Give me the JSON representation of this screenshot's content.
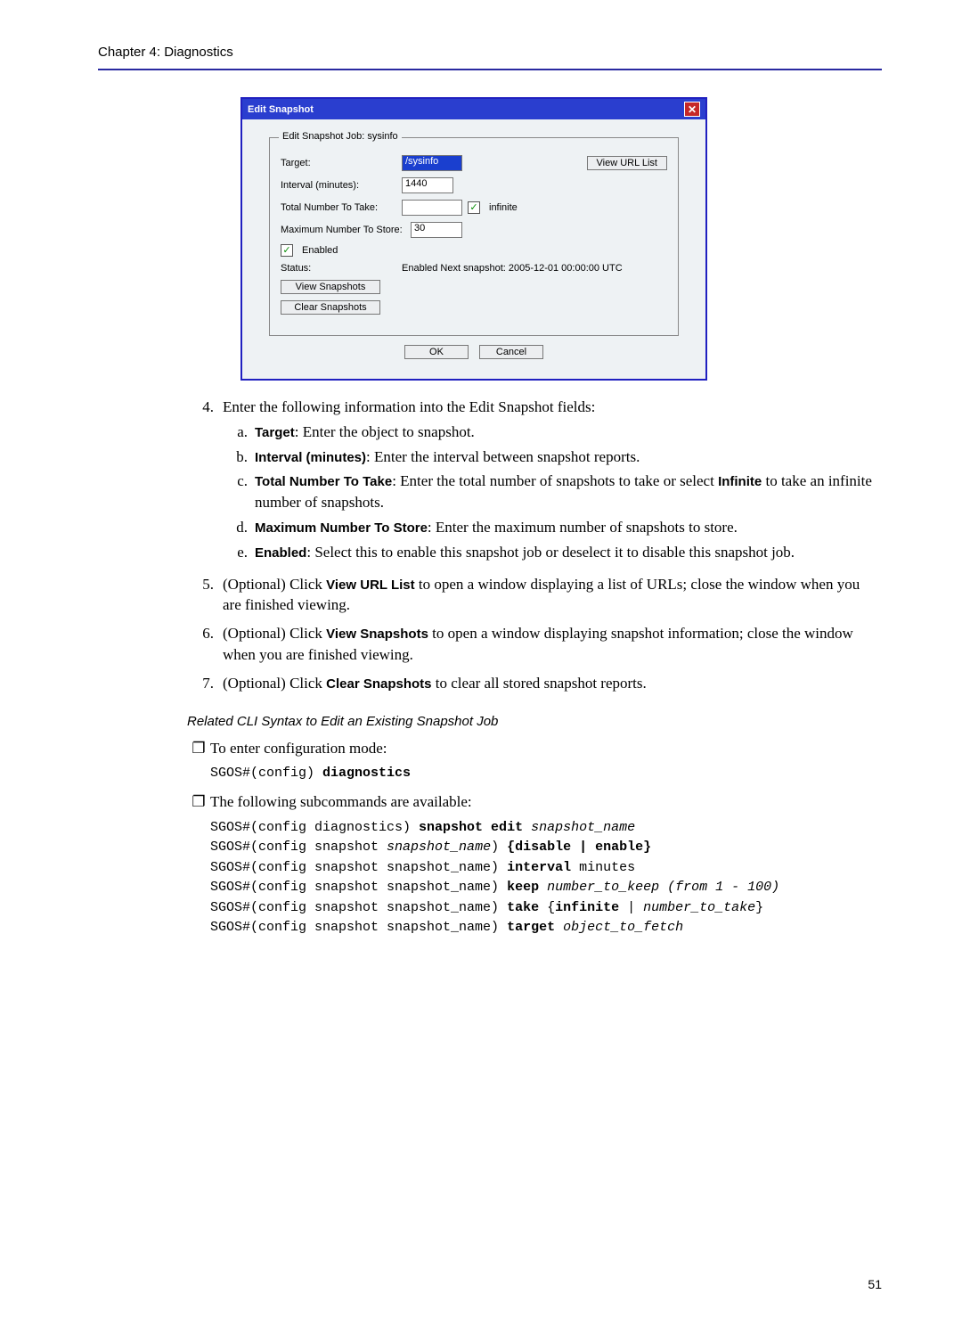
{
  "header": "Chapter 4:   Diagnostics",
  "dialog": {
    "title": "Edit Snapshot",
    "legend": "Edit Snapshot Job: sysinfo",
    "labels": {
      "target": "Target:",
      "interval": "Interval (minutes):",
      "total": "Total Number To Take:",
      "max": "Maximum Number To Store:",
      "enabled_cb": "Enabled",
      "infinite_cb": "infinite",
      "status": "Status:"
    },
    "values": {
      "target": "/sysinfo",
      "interval": "1440",
      "total": "",
      "max": "30",
      "status": "Enabled    Next snapshot: 2005-12-01 00:00:00 UTC"
    },
    "buttons": {
      "view_url": "View URL List",
      "view_snap": "View Snapshots",
      "clear_snap": "Clear Snapshots",
      "ok": "OK",
      "cancel": "Cancel"
    }
  },
  "steps": {
    "s4": {
      "num": "4.",
      "text": "Enter the following information into the Edit Snapshot fields:",
      "a_letter": "a.",
      "a_bold": "Target",
      "a_rest": ": Enter the object to snapshot.",
      "b_letter": "b.",
      "b_bold": "Interval (minutes)",
      "b_rest": ": Enter the interval between snapshot reports.",
      "c_letter": "c.",
      "c_bold": "Total Number To Take",
      "c_rest1": ": Enter the total number of snapshots to take or select ",
      "c_bold2": "Infinite",
      "c_rest2": " to take an infinite number of snapshots.",
      "d_letter": "d.",
      "d_bold": "Maximum Number To Store",
      "d_rest": ": Enter the maximum number of snapshots to store.",
      "e_letter": "e.",
      "e_bold": "Enabled",
      "e_rest": ": Select this to enable this snapshot job or deselect it to disable this snapshot job."
    },
    "s5": {
      "num": "5.",
      "pre": "(Optional) Click ",
      "bold": "View URL List",
      "post": " to open a window displaying a list of URLs; close the window when you are finished viewing."
    },
    "s6": {
      "num": "6.",
      "pre": "(Optional) Click ",
      "bold": "View Snapshots",
      "post": " to open a window displaying snapshot information; close the window when you are finished viewing."
    },
    "s7": {
      "num": "7.",
      "pre": "(Optional) Click ",
      "bold": "Clear Snapshots",
      "post": " to clear all stored snapshot reports."
    }
  },
  "cli": {
    "title": "Related CLI Syntax to Edit an Existing Snapshot Job",
    "b1": "To enter configuration mode:",
    "c1a": "SGOS#(config) ",
    "c1b": "diagnostics",
    "b2": "The following subcommands are available:",
    "l1a": "SGOS#(config diagnostics) ",
    "l1b": "snapshot edit ",
    "l1c": "snapshot_name",
    "l2a": "SGOS#(config snapshot ",
    "l2b": "snapshot_name",
    "l2c": ") ",
    "l2d": "{disable | enable}",
    "l3a": "SGOS#(config snapshot snapshot_name) ",
    "l3b": "interval ",
    "l3c": "minutes",
    "l4a": "SGOS#(config snapshot snapshot_name) ",
    "l4b": "keep ",
    "l4c": "number_to_keep (from 1 - 100)",
    "l5a": "SGOS#(config snapshot snapshot_name) ",
    "l5b": "take ",
    "l5c": "{",
    "l5d": "infinite",
    "l5e": " | ",
    "l5f": "number_to_take",
    "l5g": "}",
    "l6a": "SGOS#(config snapshot snapshot_name) ",
    "l6b": "target ",
    "l6c": "object_to_fetch"
  },
  "page_number": "51",
  "bullet_glyph": "❐"
}
